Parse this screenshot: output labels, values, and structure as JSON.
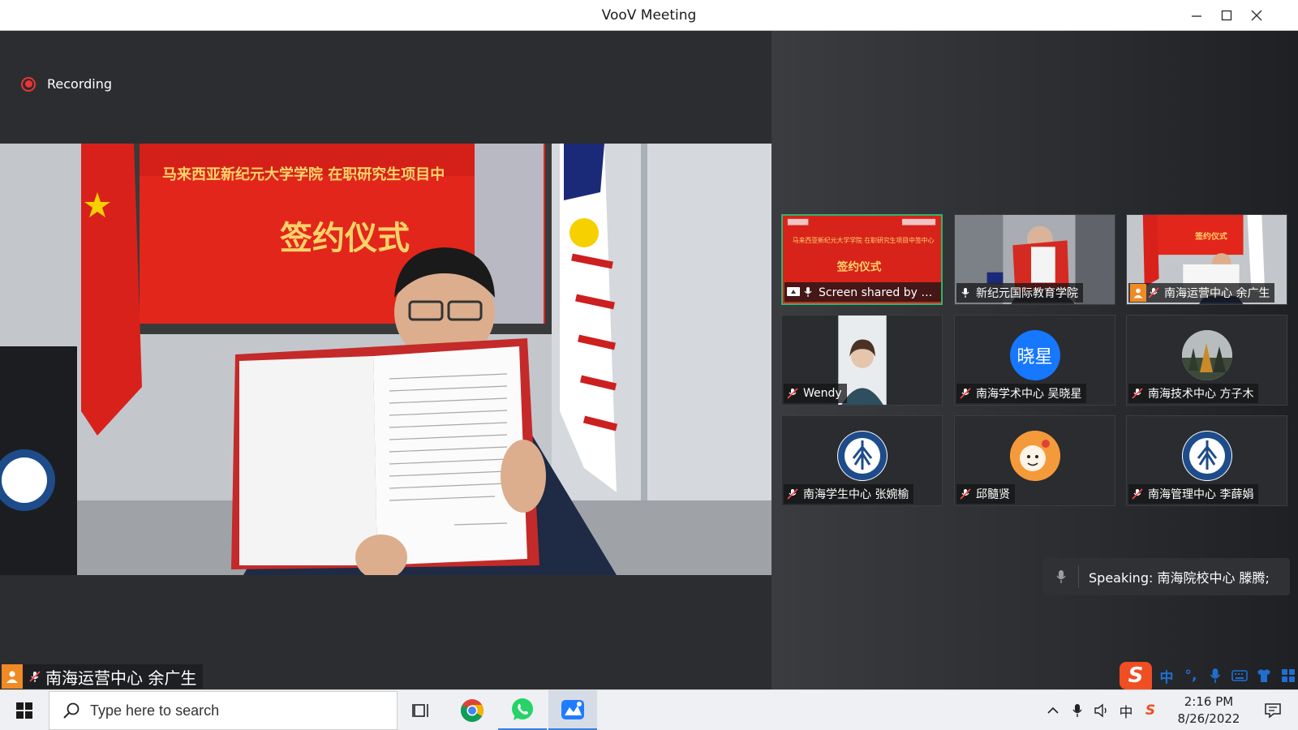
{
  "window": {
    "title": "VooV Meeting",
    "controls": [
      "minimize-icon",
      "maximize-icon",
      "close-icon"
    ]
  },
  "main": {
    "recording_label": "Recording",
    "banner_line1": "马来西亚新纪元大学学院 在职研究生项目中",
    "banner_line2": "签约仪式",
    "active_speaker_name": "南海运营中心 余广生"
  },
  "gallery": {
    "tiles": [
      {
        "name": "Screen shared by 南...",
        "type": "screen-share",
        "mic": "on",
        "active": true,
        "banner": "签约仪式",
        "banner_small": "马来西亚新纪元大学学院 在职研究生项目中签中心"
      },
      {
        "name": "新纪元国际教育学院",
        "type": "video",
        "mic": "on"
      },
      {
        "name": "南海运营中心 余广生",
        "type": "video",
        "mic": "muted",
        "banner": "签约仪式"
      },
      {
        "name": "Wendy",
        "type": "video",
        "mic": "muted"
      },
      {
        "name": "南海学术中心 吴晓星",
        "type": "avatar-text",
        "mic": "muted",
        "avatar_text": "晓星"
      },
      {
        "name": "南海技术中心 方子木",
        "type": "avatar-image",
        "mic": "muted"
      },
      {
        "name": "南海学生中心 张婉榆",
        "type": "avatar-logo",
        "mic": "muted"
      },
      {
        "name": "邱髓贤",
        "type": "avatar-cartoon",
        "mic": "muted"
      },
      {
        "name": "南海管理中心 李薛娟",
        "type": "avatar-logo",
        "mic": "muted"
      }
    ],
    "speaking_text": "Speaking: 南海院校中心 滕腾;"
  },
  "ime": {
    "logo": "S",
    "items": [
      "中",
      "°,",
      "mic-icon",
      "keyboard-icon",
      "shirt-icon",
      "grid-icon"
    ]
  },
  "taskbar": {
    "search_placeholder": "Type here to search",
    "apps": [
      "task-view-icon",
      "chrome-icon",
      "whatsapp-icon",
      "voov-meeting-icon"
    ],
    "tray_lang": "中",
    "tray_ime": "S",
    "time": "2:16 PM",
    "date": "8/26/2022"
  },
  "colors": {
    "accent_green": "#2fb36b",
    "recording_red": "#ee3333",
    "avatar_blue": "#1677ff",
    "badge_orange": "#f08a24",
    "taskbar_blue": "#3b7ddd"
  }
}
